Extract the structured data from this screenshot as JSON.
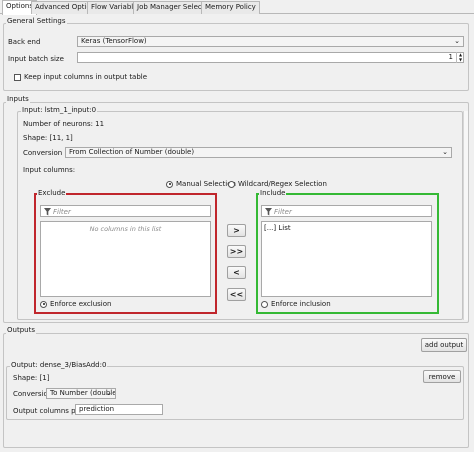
{
  "tabs": [
    "Options",
    "Advanced Options",
    "Flow Variables",
    "Job Manager Selection",
    "Memory Policy"
  ],
  "general": {
    "title": "General Settings",
    "backend_label": "Back end",
    "backend_value": "Keras (TensorFlow)",
    "batch_label": "Input batch size",
    "batch_value": "1",
    "keep_label": "Keep input columns in output table"
  },
  "inputs": {
    "title": "Inputs",
    "input_name": "Input: lstm_1_input:0",
    "neurons": "Number of neurons: 11",
    "shape": "Shape: [11, 1]",
    "conversion_label": "Conversion",
    "conversion_value": "From Collection of Number (double)",
    "columns_label": "Input columns:",
    "manual_label": "Manual Selection",
    "wildcard_label": "Wildcard/Regex Selection",
    "exclude_title": "Exclude",
    "include_title": "Include",
    "filter_placeholder": "Filter",
    "no_columns": "No columns in this list",
    "include_item": "[...] List",
    "enforce_exclusion": "Enforce exclusion",
    "enforce_inclusion": "Enforce inclusion",
    "move_buttons": [
      ">",
      ">>",
      "<",
      "<<"
    ]
  },
  "outputs": {
    "title": "Outputs",
    "add_output": "add output",
    "output_name": "Output: dense_3/BiasAdd:0",
    "shape": "Shape: [1]",
    "remove": "remove",
    "conversion_label": "Conversion",
    "conversion_value": "To Number (double)",
    "prefix_label": "Output columns prefix",
    "prefix_value": "prediction"
  },
  "colors": {
    "exclude_border": "#c0262c",
    "include_border": "#35b935"
  }
}
